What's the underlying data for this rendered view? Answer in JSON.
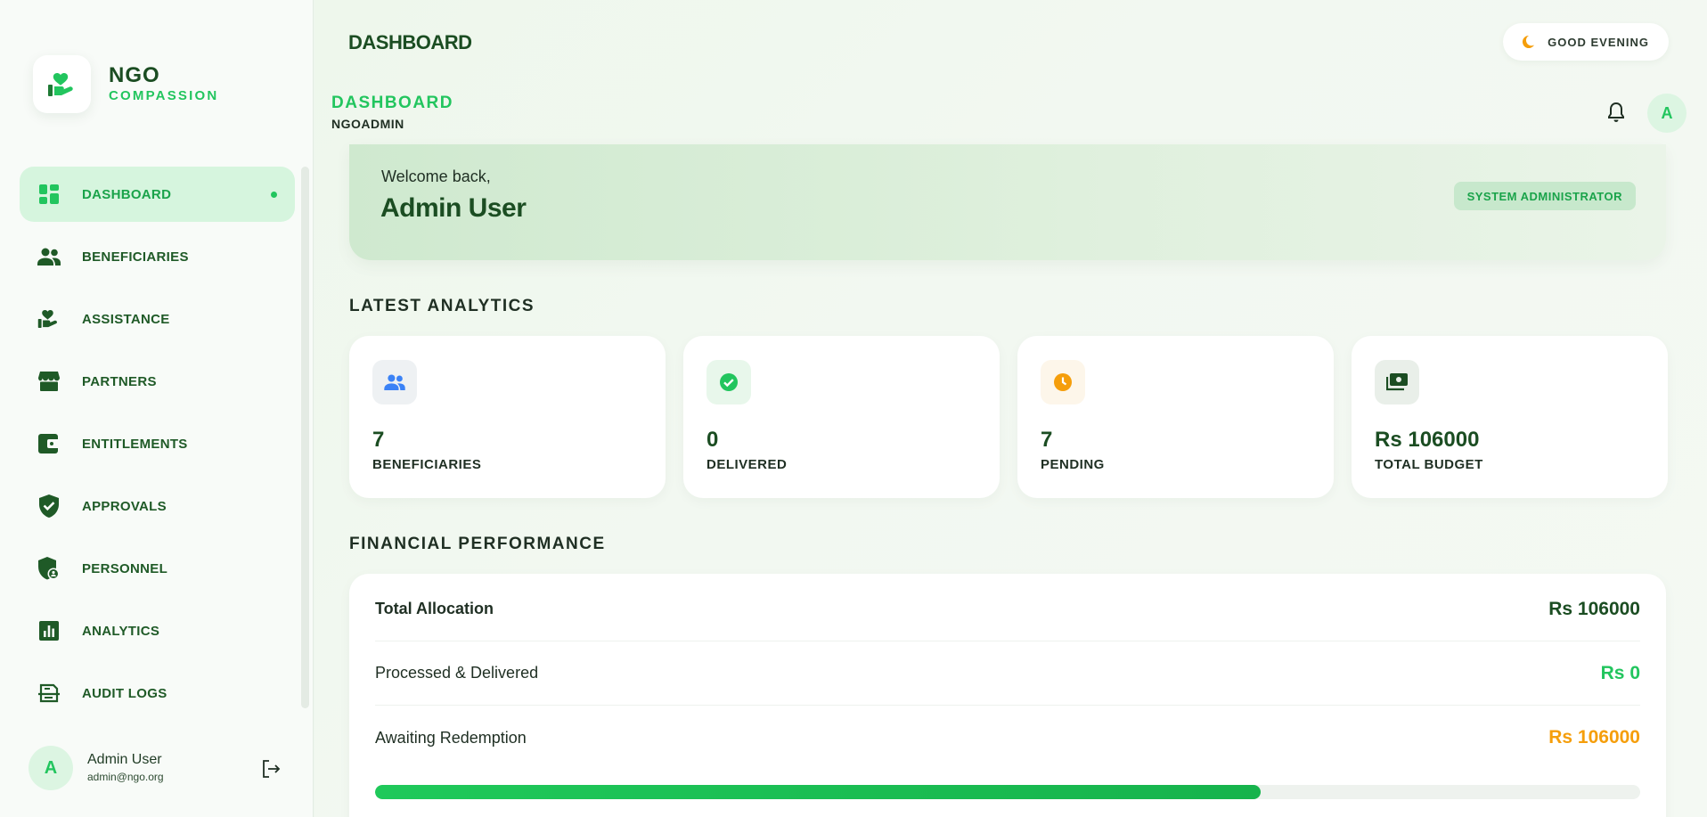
{
  "brand": {
    "name": "NGO",
    "subtitle": "COMPASSION",
    "logo_icon": "hand-heart-icon",
    "accent": "#22c55e"
  },
  "sidebar": {
    "items": [
      {
        "label": "DASHBOARD",
        "icon": "grid-icon",
        "active": true
      },
      {
        "label": "BENEFICIARIES",
        "icon": "people-icon"
      },
      {
        "label": "ASSISTANCE",
        "icon": "hand-heart-icon"
      },
      {
        "label": "PARTNERS",
        "icon": "storefront-icon"
      },
      {
        "label": "ENTITLEMENTS",
        "icon": "wallet-icon"
      },
      {
        "label": "APPROVALS",
        "icon": "shield-check-icon"
      },
      {
        "label": "PERSONNEL",
        "icon": "shield-person-icon"
      },
      {
        "label": "ANALYTICS",
        "icon": "bar-chart-icon"
      },
      {
        "label": "AUDIT LOGS",
        "icon": "scan-doc-icon"
      }
    ]
  },
  "user": {
    "initial": "A",
    "name": "Admin User",
    "email": "admin@ngo.org"
  },
  "header": {
    "title": "DASHBOARD",
    "greeting": "GOOD EVENING",
    "page_title": "DASHBOARD",
    "page_caption": "NGOADMIN",
    "avatar_initial": "A"
  },
  "welcome": {
    "small": "Welcome back,",
    "name": "Admin User",
    "role": "SYSTEM ADMINISTRATOR"
  },
  "analytics": {
    "title": "LATEST ANALYTICS",
    "cards": [
      {
        "value": "7",
        "label": "BENEFICIARIES",
        "icon": "people-icon",
        "icon_color": "#3b82f6",
        "icon_bg": "#eef1f3"
      },
      {
        "value": "0",
        "label": "DELIVERED",
        "icon": "check-circle-icon",
        "icon_color": "#22c55e",
        "icon_bg": "#e8f7eb"
      },
      {
        "value": "7",
        "label": "PENDING",
        "icon": "clock-icon",
        "icon_color": "#f59e0b",
        "icon_bg": "#fdf6ea"
      },
      {
        "value": "Rs 106000",
        "label": "TOTAL BUDGET",
        "icon": "money-icon",
        "icon_color": "#1b4d22",
        "icon_bg": "#e9efe9"
      }
    ]
  },
  "financial": {
    "title": "FINANCIAL PERFORMANCE",
    "rows": [
      {
        "label": "Total Allocation",
        "value": "Rs 106000",
        "color": "#1b4d22"
      },
      {
        "label": "Processed & Delivered",
        "value": "Rs 0",
        "color": "#22c55e"
      },
      {
        "label": "Awaiting Redemption",
        "value": "Rs 106000",
        "color": "#f59e0b"
      }
    ],
    "progress_fraction": 0.7
  }
}
